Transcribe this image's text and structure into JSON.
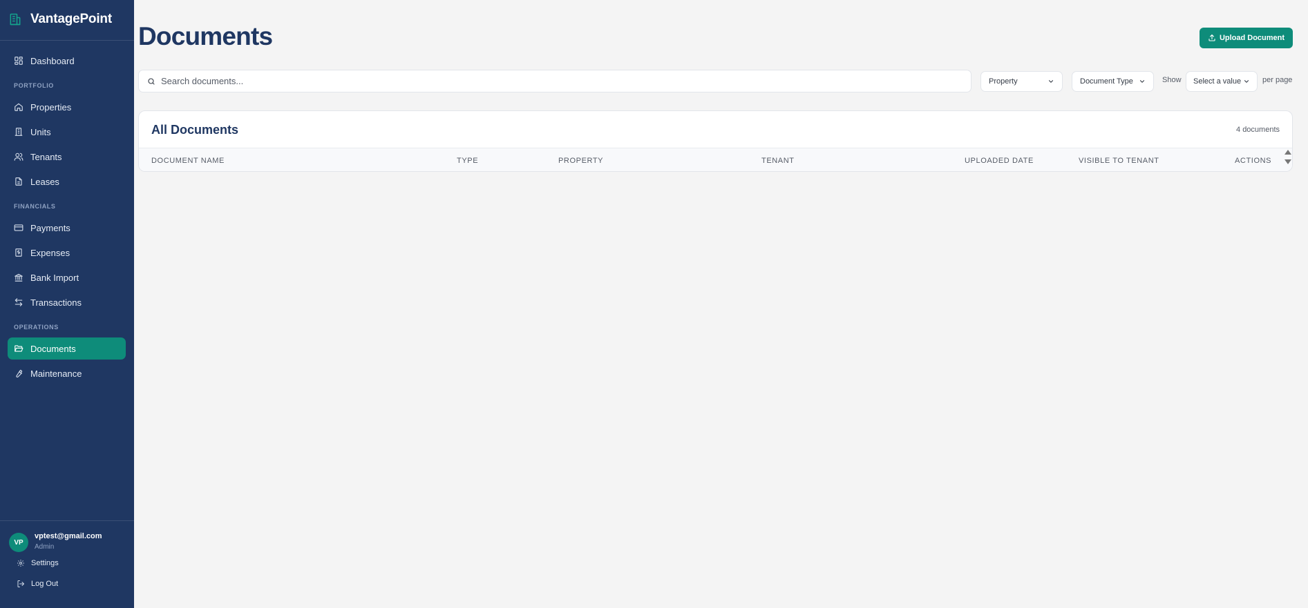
{
  "brand": {
    "name": "VantagePoint",
    "icon": "building-icon",
    "accent": "#0e8c7a"
  },
  "sidebar": {
    "background": "#1f3762",
    "items": [
      {
        "label": "Dashboard",
        "icon": "dashboard-icon"
      },
      {
        "label": "Properties",
        "icon": "home-icon"
      },
      {
        "label": "Units",
        "icon": "building-columns-icon"
      },
      {
        "label": "Tenants",
        "icon": "users-icon"
      },
      {
        "label": "Leases",
        "icon": "file-text-icon"
      },
      {
        "label": "Payments",
        "icon": "credit-card-icon"
      },
      {
        "label": "Expenses",
        "icon": "receipt-icon"
      },
      {
        "label": "Bank Import",
        "icon": "bank-icon"
      },
      {
        "label": "Transactions",
        "icon": "arrows-exchange-icon"
      },
      {
        "label": "Documents",
        "icon": "folder-open-icon",
        "active": true
      },
      {
        "label": "Maintenance",
        "icon": "wrench-icon"
      }
    ],
    "sections": [
      "PORTFOLIO",
      "FINANCIALS",
      "OPERATIONS"
    ]
  },
  "user": {
    "initials": "VP",
    "email": "vptest@gmail.com",
    "role": "Admin",
    "settings_label": "Settings",
    "logout_label": "Log Out"
  },
  "page": {
    "title": "Documents"
  },
  "toolbar": {
    "upload_label": "Upload Document"
  },
  "search": {
    "placeholder": "Search documents..."
  },
  "filters": {
    "property_label": "Property",
    "document_type_label": "Document Type",
    "show_label": "Show",
    "per_page_placeholder": "Select a value",
    "per_page_label": "per page"
  },
  "table": {
    "title": "All Documents",
    "count": "4 documents",
    "columns": [
      "DOCUMENT NAME",
      "TYPE",
      "PROPERTY",
      "TENANT",
      "UPLOADED DATE",
      "VISIBLE TO TENANT",
      "ACTIONS"
    ],
    "rows": []
  }
}
